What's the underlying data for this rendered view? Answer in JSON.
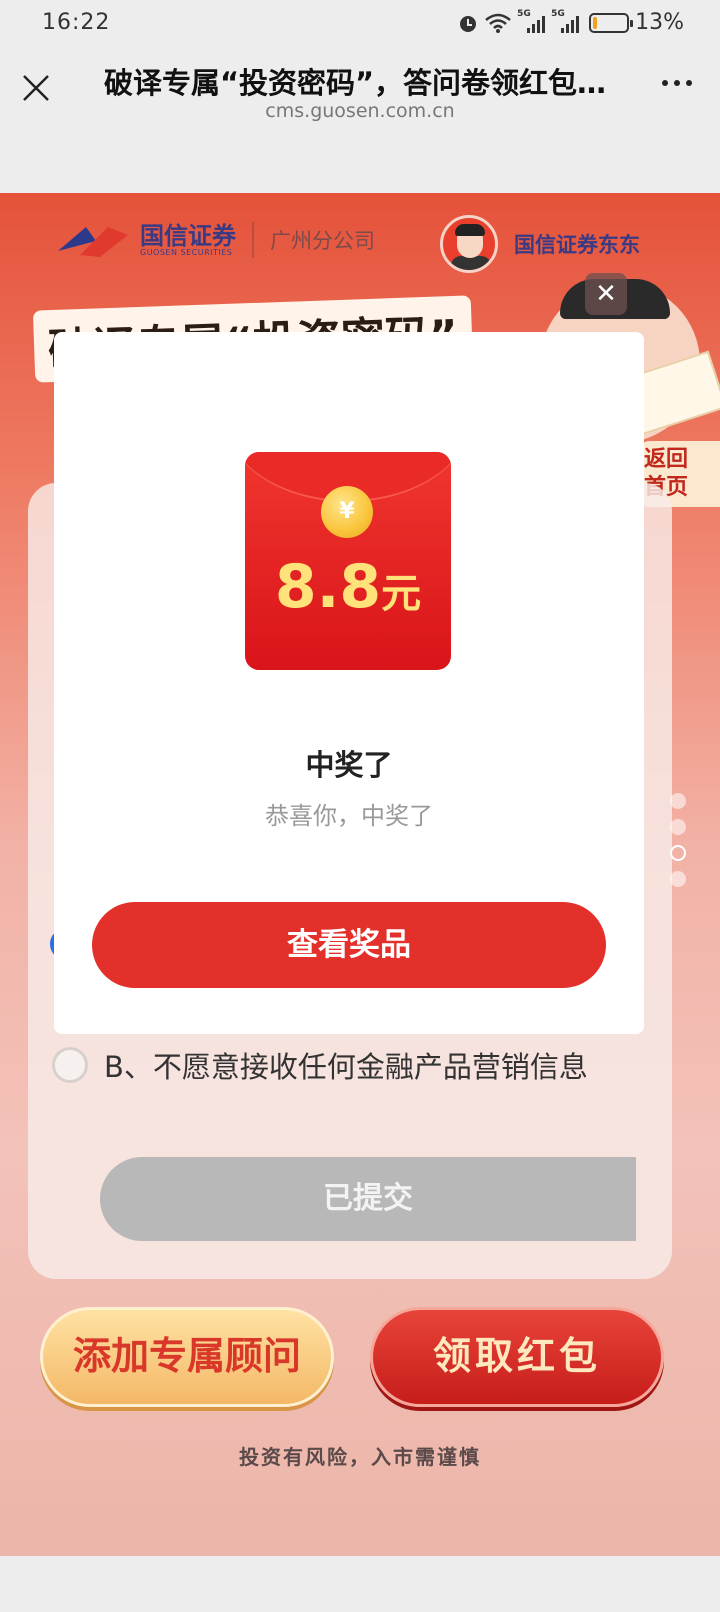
{
  "status_bar": {
    "time": "16:22",
    "network_1": "5G",
    "network_2": "5G",
    "battery_text": "13%",
    "battery_level": 0.13,
    "icons": [
      "alarm-icon",
      "wifi-icon",
      "signal-icon",
      "battery-icon"
    ]
  },
  "titlebar": {
    "title": "破译专属“投资密码”，答问卷领红包…",
    "url": "cms.guosen.com.cn"
  },
  "brand": {
    "logo_name": "国信证券",
    "logo_en": "GUOSEN SECURITIES",
    "branch": "广州分公司",
    "host_name": "国信证券东东"
  },
  "page": {
    "headline": "破译专属“投资密码”",
    "back_home": [
      "返回",
      "首页"
    ],
    "option_b": "B、不愿意接收任何金融产品营销信息",
    "submitted_label": "已提交",
    "advisor_button": "添加专属顾问",
    "redpack_button": "领取红包",
    "risk_note": "投资有风险，入市需谨慎"
  },
  "modal": {
    "coin_symbol": "¥",
    "amount": "8.8",
    "amount_unit": "元",
    "title": "中奖了",
    "subtitle": "恭喜你，中奖了",
    "button": "查看奖品",
    "close_symbol": "✕"
  },
  "colors": {
    "primary_red": "#e3302a",
    "page_top": "#e5523a",
    "gold_text": "#ffe27a"
  }
}
